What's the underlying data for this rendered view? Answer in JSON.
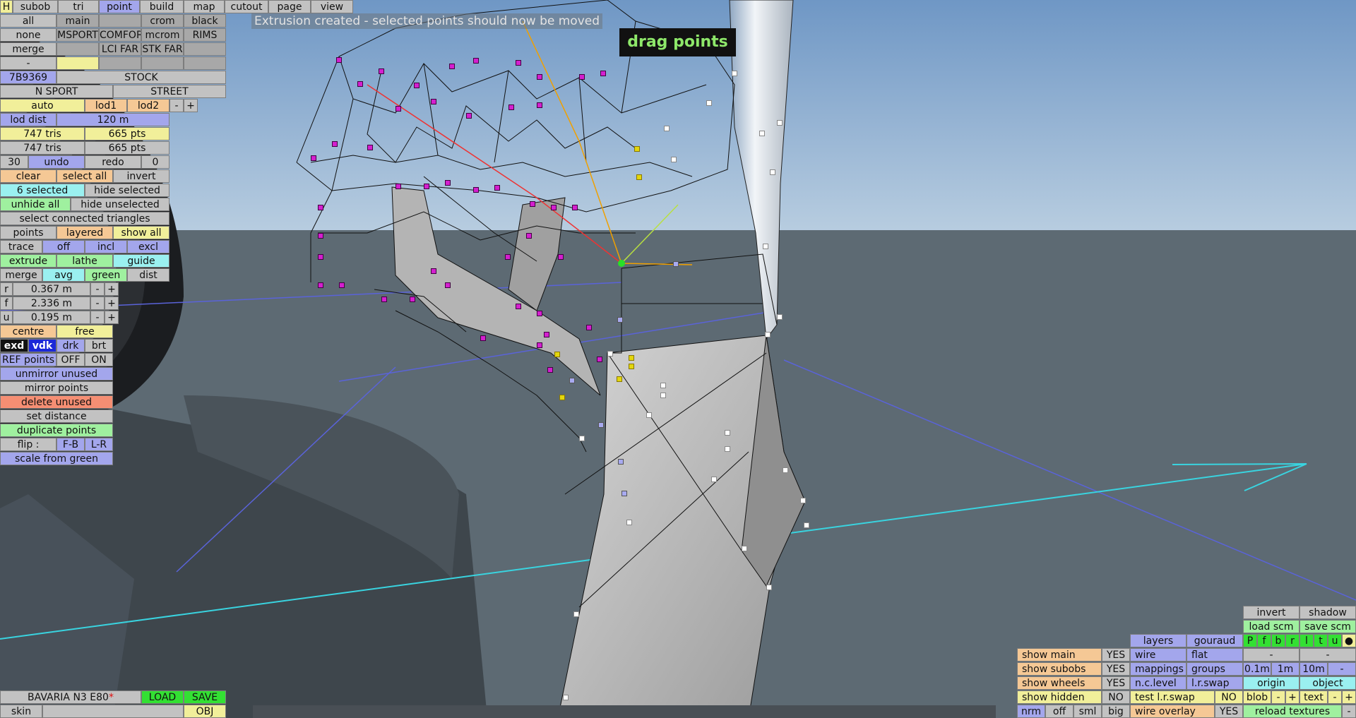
{
  "status_message": "Extrusion created - selected points should now be moved",
  "tooltip": "drag points",
  "top_menu": {
    "h": "H",
    "subob": "subob",
    "tri": "tri",
    "point": "point",
    "build": "build",
    "map": "map",
    "cutout": "cutout",
    "page": "page",
    "view": "view"
  },
  "row_all": {
    "all": "all",
    "main": "main",
    "crom": "crom",
    "black": "black"
  },
  "row_none": {
    "none": "none",
    "msport": "MSPORT",
    "comfort": "COMFORT",
    "mcrom": "mcrom",
    "rims": "RIMS"
  },
  "row_merge": {
    "merge": "merge",
    "lci_far": "LCI FAR",
    "stk_far": "STK FAR"
  },
  "row_dash": {
    "dash": "-"
  },
  "row_code": {
    "code": "7B9369",
    "stock": "STOCK"
  },
  "row_sport": {
    "n_sport": "N SPORT",
    "street": "STREET"
  },
  "row_lod": {
    "auto": "auto",
    "lod1": "lod1",
    "lod2": "lod2",
    "minus": "-",
    "plus": "+"
  },
  "lod_dist": {
    "label": "lod dist",
    "value": "120 m"
  },
  "tris_row1": {
    "tris": "747 tris",
    "pts": "665 pts"
  },
  "tris_row2": {
    "tris": "747 tris",
    "pts": "665 pts"
  },
  "undo_row": {
    "count": "30",
    "undo": "undo",
    "redo": "redo",
    "redo_count": "0"
  },
  "select_row": {
    "clear": "clear",
    "select_all": "select all",
    "invert": "invert"
  },
  "hide_row": {
    "selected": "6 selected",
    "hide_selected": "hide selected"
  },
  "unhide_row": {
    "unhide_all": "unhide all",
    "hide_unselected": "hide unselected"
  },
  "connected": "select connected triangles",
  "points_row": {
    "points": "points",
    "layered": "layered",
    "show_all": "show all"
  },
  "trace_row": {
    "trace": "trace",
    "off": "off",
    "incl": "incl",
    "excl": "excl"
  },
  "extrude_row": {
    "extrude": "extrude",
    "lathe": "lathe",
    "guide": "guide"
  },
  "merge_row": {
    "merge": "merge",
    "avg": "avg",
    "green": "green",
    "dist": "dist"
  },
  "coords": [
    {
      "axis": "r",
      "value": "0.367 m",
      "minus": "-",
      "plus": "+"
    },
    {
      "axis": "f",
      "value": "2.336 m",
      "minus": "-",
      "plus": "+"
    },
    {
      "axis": "u",
      "value": "0.195 m",
      "minus": "-",
      "plus": "+"
    }
  ],
  "centre_row": {
    "centre": "centre",
    "free": "free"
  },
  "shade_row": {
    "exd": "exd",
    "vdk": "vdk",
    "drk": "drk",
    "brt": "brt"
  },
  "ref_row": {
    "ref": "REF points",
    "off": "OFF",
    "on": "ON"
  },
  "unmirror": "unmirror unused",
  "mirror": "mirror points",
  "delete_unused": "delete unused",
  "set_distance": "set distance",
  "duplicate": "duplicate points",
  "flip_row": {
    "flip": "flip :",
    "fb": "F-B",
    "lr": "L-R"
  },
  "scale_green": "scale from green",
  "bottom_left": {
    "car_name": "BAVARIA N3 E80",
    "modified_marker": "*",
    "load": "LOAD",
    "save": "SAVE",
    "skin": "skin",
    "obj": "OBJ"
  },
  "bottom_right": {
    "invert": "invert",
    "shadow": "shadow",
    "load_scm": "load scm",
    "save_scm": "save scm",
    "layers": "layers",
    "gouraud": "gouraud",
    "layer_keys": [
      "P",
      "f",
      "b",
      "r",
      "l",
      "t",
      "u"
    ],
    "dot": "●",
    "dash1": "-",
    "dash2": "-",
    "show_main": "show main",
    "show_main_val": "YES",
    "wire": "wire",
    "flat": "flat",
    "show_subobs": "show subobs",
    "show_subobs_val": "YES",
    "mappings": "mappings",
    "groups": "groups",
    "step1": "0.1m",
    "step2": "1m",
    "step3": "10m",
    "step_minus": "-",
    "show_wheels": "show wheels",
    "show_wheels_val": "YES",
    "nc_level": "n.c.level",
    "lr_swap": "l.r.swap",
    "origin": "origin",
    "object": "object",
    "show_hidden": "show hidden",
    "show_hidden_val": "NO",
    "test_lr_swap": "test l.r.swap",
    "test_lr_swap_val": "NO",
    "blob": "blob",
    "blob_minus": "-",
    "blob_plus": "+",
    "text": "text",
    "text_minus": "-",
    "text_plus": "+",
    "nrm": "nrm",
    "off": "off",
    "sml": "sml",
    "big": "big",
    "wire_overlay": "wire overlay",
    "wire_overlay_val": "YES",
    "reload_textures": "reload textures",
    "reload_minus": "-"
  },
  "colors": {
    "sky": "#7ea3c8",
    "ground": "#5e6b75",
    "point_selected": "#d41fcf",
    "point_white": "#ffffff",
    "tooltip_text": "#8ee86a"
  }
}
